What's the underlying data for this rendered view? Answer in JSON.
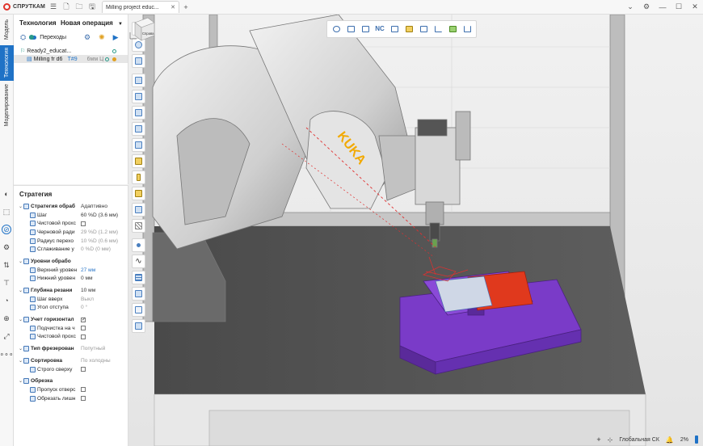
{
  "app": {
    "logo_text": "СПРУТКАМ",
    "tab_title": "Milling project educ..."
  },
  "vtabs": {
    "model": "Модель",
    "technology": "Технология",
    "modeling": "Моделирование"
  },
  "tech_panel": {
    "title": "Технология",
    "new_operation": "Новая операция",
    "transitions": "Переходы",
    "tree": [
      {
        "label": "Ready2_educat..."
      },
      {
        "label": "Milling fr d6",
        "tool": "T#9",
        "extra": "6мм Ц"
      }
    ]
  },
  "strategy_panel": {
    "title": "Стратегия",
    "rows": [
      {
        "indent": 0,
        "group": true,
        "name": "Стратегия обраб",
        "value": "Адаптивно",
        "style": "normal"
      },
      {
        "indent": 1,
        "name": "Шаг",
        "value": "60 %D (3.6 мм)",
        "style": "normal"
      },
      {
        "indent": 1,
        "name": "Чистовой прохс",
        "checkbox": false
      },
      {
        "indent": 1,
        "name": "Черновой ради",
        "value": "29 %D (1.2 мм)",
        "style": "muted"
      },
      {
        "indent": 1,
        "name": "Радиус перехо",
        "value": "10 %D (0.6 мм)",
        "style": "muted"
      },
      {
        "indent": 1,
        "name": "Сглаживание у",
        "value": "0 %D (0 мм)",
        "style": "muted"
      },
      {
        "indent": 0,
        "spacer": true
      },
      {
        "indent": 0,
        "group": true,
        "name": "Уровни обрабо",
        "value": "",
        "style": "normal"
      },
      {
        "indent": 1,
        "name": "Верхний уровен",
        "value": "27 мм",
        "style": "blue"
      },
      {
        "indent": 1,
        "name": "Нижний уровен",
        "value": "0 мм",
        "style": "normal"
      },
      {
        "indent": 0,
        "spacer": true
      },
      {
        "indent": 0,
        "group": true,
        "name": "Глубина резани",
        "value": "10 мм",
        "style": "normal"
      },
      {
        "indent": 1,
        "name": "Шаг вверх",
        "value": "Выкл",
        "style": "muted"
      },
      {
        "indent": 1,
        "name": "Угол отступа",
        "value": "0 °",
        "style": "muted"
      },
      {
        "indent": 0,
        "spacer": true
      },
      {
        "indent": 0,
        "group": true,
        "name": "Учет горизонтал",
        "checkbox": true
      },
      {
        "indent": 1,
        "name": "Подчистка на ч",
        "checkbox": false
      },
      {
        "indent": 1,
        "name": "Чистовой прохс",
        "checkbox": false
      },
      {
        "indent": 0,
        "spacer": true
      },
      {
        "indent": 0,
        "group": true,
        "name": "Тип фрезерован",
        "value": "Попутный",
        "style": "muted"
      },
      {
        "indent": 0,
        "spacer": true
      },
      {
        "indent": 0,
        "group": true,
        "name": "Сортировка",
        "value": "По холодны",
        "style": "muted"
      },
      {
        "indent": 1,
        "name": "Строго сверху",
        "checkbox": false
      },
      {
        "indent": 0,
        "spacer": true
      },
      {
        "indent": 0,
        "group": true,
        "name": "Обрезка",
        "value": "",
        "style": "normal"
      },
      {
        "indent": 1,
        "name": "Пропуск отверс",
        "checkbox": false
      },
      {
        "indent": 1,
        "name": "Обрезать лишн",
        "checkbox": false
      }
    ]
  },
  "viewport": {
    "robot_label": "KUKA",
    "navcube_label": "Справа",
    "status": {
      "coords": "Глобальная СК",
      "zoom": "2%"
    }
  },
  "colors": {
    "accent": "#1f72c6",
    "workpiece": "#7a3bc8",
    "stock": "#e0391d",
    "robot": "#d9d9d9"
  }
}
